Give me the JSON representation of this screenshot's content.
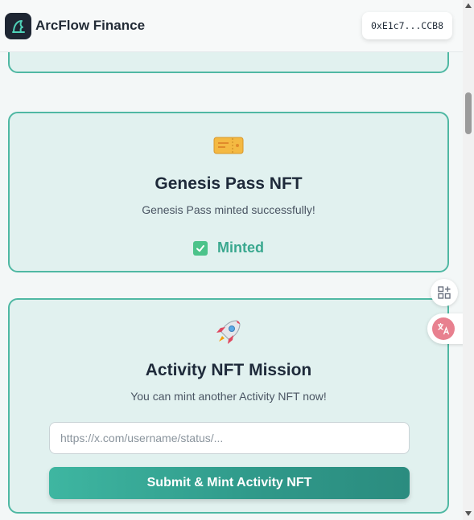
{
  "header": {
    "brand": "ArcFlow Finance",
    "wallet_address": "0xE1c7...CCB8"
  },
  "genesis_card": {
    "icon": "ticket-icon",
    "title": "Genesis Pass NFT",
    "subtitle": "Genesis Pass minted successfully!",
    "status_label": "Minted"
  },
  "activity_card": {
    "icon": "rocket-icon",
    "title": "Activity NFT Mission",
    "subtitle": "You can mint another Activity NFT now!",
    "input_placeholder": "https://x.com/username/status/...",
    "input_value": "",
    "submit_label": "Submit & Mint Activity NFT"
  },
  "side_tools": {
    "apps_icon": "apps-add-icon",
    "translate_icon": "translate-icon"
  },
  "colors": {
    "accent": "#3eb6a1",
    "card_bg": "#e1f1ef",
    "card_border": "#4fb8a3",
    "minted_text": "#3aa88f"
  }
}
